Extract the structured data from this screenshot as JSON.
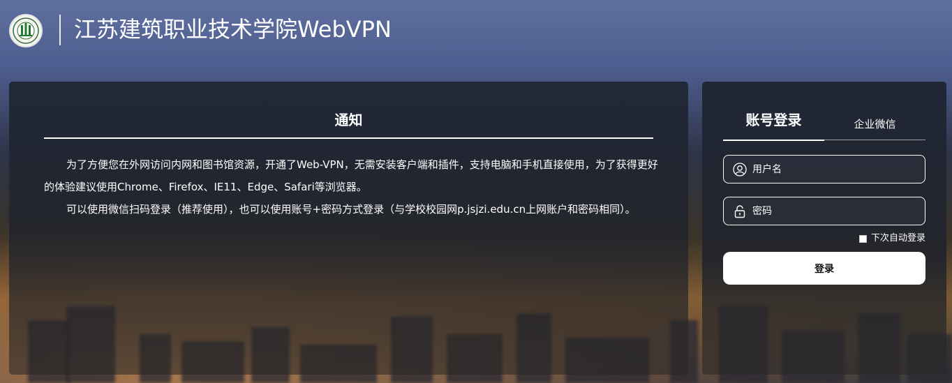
{
  "header": {
    "site_title": "江苏建筑职业技术学院WebVPN"
  },
  "notice": {
    "title": "通知",
    "paragraphs": [
      "为了方便您在外网访问内网和图书馆资源，开通了Web-VPN，无需安装客户端和插件，支持电脑和手机直接使用，为了获得更好的体验建议使用Chrome、Firefox、IE11、Edge、Safari等浏览器。",
      "可以使用微信扫码登录（推荐使用），也可以使用账号+密码方式登录（与学校校园网p.jsjzi.edu.cn上网账户和密码相同）。"
    ]
  },
  "login": {
    "tabs": [
      "账号登录",
      "企业微信"
    ],
    "active_tab": "账号登录",
    "username_placeholder": "用户名",
    "password_placeholder": "密码",
    "remember_label": "下次自动登录",
    "submit_label": "登录"
  },
  "colors": {
    "panel_bg": "#1e2432",
    "text": "#ffffff",
    "button_bg": "#ffffff",
    "button_text": "#111111"
  },
  "icons": {
    "logo": "school-seal-logo",
    "username": "user-icon",
    "password": "lock-icon"
  }
}
